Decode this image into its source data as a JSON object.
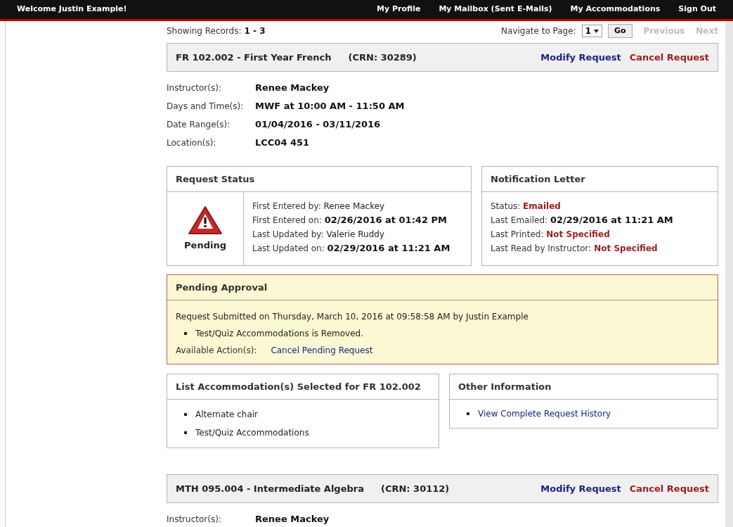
{
  "header": {
    "welcome": "Welcome Justin Example!",
    "nav": [
      "My Profile",
      "My Mailbox (Sent E-Mails)",
      "My Accommodations",
      "Sign Out"
    ]
  },
  "paging": {
    "showing_label": "Showing Records:",
    "showing_value": "1 - 3",
    "navigate_label": "Navigate to Page:",
    "page": "1",
    "go": "Go",
    "links": [
      {
        "label": "Previous",
        "disabled": true
      },
      {
        "label": "Next",
        "disabled": true
      }
    ]
  },
  "records": [
    {
      "course": "FR 102.002 - First Year French",
      "crn": "(CRN: 30289)",
      "actions": [
        {
          "label": "Modify Request",
          "kind": "modify"
        },
        {
          "label": "Cancel Request",
          "kind": "cancel"
        }
      ],
      "details": [
        {
          "label": "Instructor(s):",
          "value": "Renee Mackey"
        },
        {
          "label": "Days and Time(s):",
          "value": "MWF at 10:00 AM - 11:50 AM"
        },
        {
          "label": "Date Range(s):",
          "value": "01/04/2016 - 03/11/2016"
        },
        {
          "label": "Location(s):",
          "value": "LCC04 451"
        }
      ],
      "request_status": {
        "title": "Request Status",
        "status": "Pending",
        "lines": [
          {
            "label": "First Entered by:",
            "value": "Renee Mackey",
            "kind": "plain"
          },
          {
            "label": "First Entered on:",
            "value": "02/26/2016 at 01:42 PM",
            "kind": "bold"
          },
          {
            "label": "Last Updated by:",
            "value": "Valerie Ruddy",
            "kind": "plain"
          },
          {
            "label": "Last Updated on:",
            "value": "02/29/2016 at 11:21 AM",
            "kind": "bold"
          }
        ]
      },
      "notification": {
        "title": "Notification Letter",
        "lines": [
          {
            "label": "Status:",
            "value": "Emailed",
            "kind": "alert"
          },
          {
            "label": "Last Emailed:",
            "value": "02/29/2016 at 11:21 AM",
            "kind": "bold"
          },
          {
            "label": "Last Printed:",
            "value": "Not Specified",
            "kind": "alert"
          },
          {
            "label": "Last Read by Instructor:",
            "value": "Not Specified",
            "kind": "alert"
          }
        ]
      },
      "pending": {
        "title": "Pending Approval",
        "submitted": "Request Submitted on Thursday, March 10, 2016 at 09:58:58 AM by Justin Example",
        "changes": [
          "Test/Quiz Accommodations is Removed."
        ],
        "actions_label": "Available Action(s):",
        "action": "Cancel Pending Request"
      },
      "accommodations": {
        "title": "List Accommodation(s) Selected for FR 102.002",
        "items": [
          "Alternate chair",
          "Test/Quiz Accommodations"
        ]
      },
      "other": {
        "title": "Other Information",
        "links": [
          "View Complete Request History"
        ]
      }
    },
    {
      "course": "MTH 095.004 - Intermediate Algebra",
      "crn": "(CRN: 30112)",
      "actions": [
        {
          "label": "Modify Request",
          "kind": "modify"
        },
        {
          "label": "Cancel Request",
          "kind": "cancel"
        }
      ],
      "details": [
        {
          "label": "Instructor(s):",
          "value": "Renee Mackey"
        }
      ]
    }
  ]
}
